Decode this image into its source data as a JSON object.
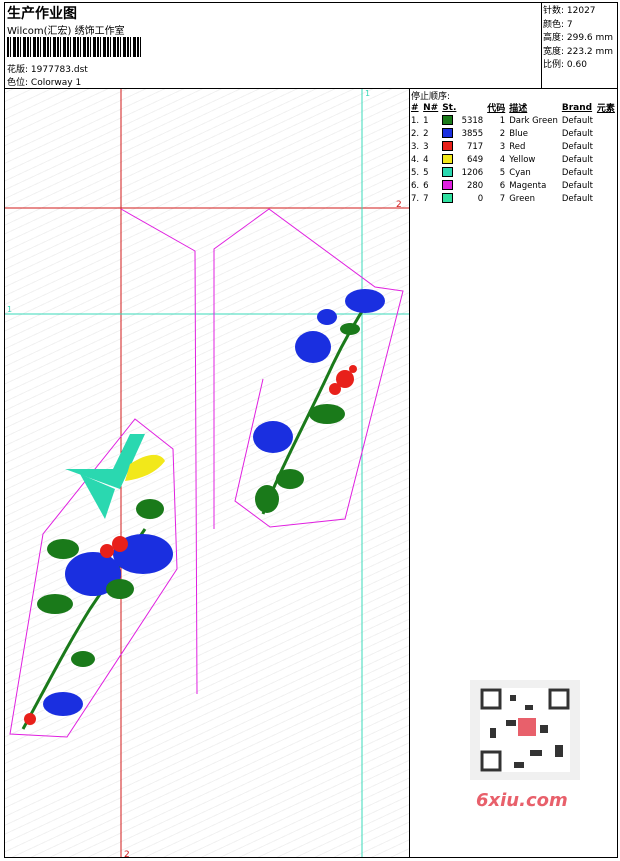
{
  "header": {
    "title": "生产作业图",
    "subtitle": "Wilcom(汇宏) 绣饰工作室",
    "design_label": "花版:",
    "design_value": "1977783.dst",
    "colorway_label": "色位:",
    "colorway_value": "Colorway 1"
  },
  "stats": {
    "stitches": "针数: 12027",
    "colors": "颜色: 7",
    "height": "高度: 299.6 mm",
    "width": "宽度: 223.2 mm",
    "scale": "比例: 0.60"
  },
  "stop_sequence": {
    "title": "停止顺序:",
    "headers": [
      "#",
      "N#",
      "St.",
      "代码",
      "描述",
      "Brand",
      "元素"
    ],
    "rows": [
      {
        "idx": "1.",
        "n": "1",
        "color": "#1a7a1a",
        "st": "5318",
        "code": "1",
        "desc": "Dark Green",
        "brand": "Default"
      },
      {
        "idx": "2.",
        "n": "2",
        "color": "#1a2fe0",
        "st": "3855",
        "code": "2",
        "desc": "Blue",
        "brand": "Default"
      },
      {
        "idx": "3.",
        "n": "3",
        "color": "#e8201a",
        "st": "717",
        "code": "3",
        "desc": "Red",
        "brand": "Default"
      },
      {
        "idx": "4.",
        "n": "4",
        "color": "#f2e81a",
        "st": "649",
        "code": "4",
        "desc": "Yellow",
        "brand": "Default"
      },
      {
        "idx": "5.",
        "n": "5",
        "color": "#2ad8b0",
        "st": "1206",
        "code": "5",
        "desc": "Cyan",
        "brand": "Default"
      },
      {
        "idx": "6.",
        "n": "6",
        "color": "#e020e0",
        "st": "280",
        "code": "6",
        "desc": "Magenta",
        "brand": "Default"
      },
      {
        "idx": "7.",
        "n": "7",
        "color": "#30e0a0",
        "st": "0",
        "code": "7",
        "desc": "Green",
        "brand": "Default"
      }
    ]
  },
  "guides": {
    "v_red_label": "2",
    "h_red_label": "2",
    "v_cyan_label": "1",
    "h_cyan_label": "1"
  },
  "watermark": {
    "text": "6xiu.com"
  }
}
